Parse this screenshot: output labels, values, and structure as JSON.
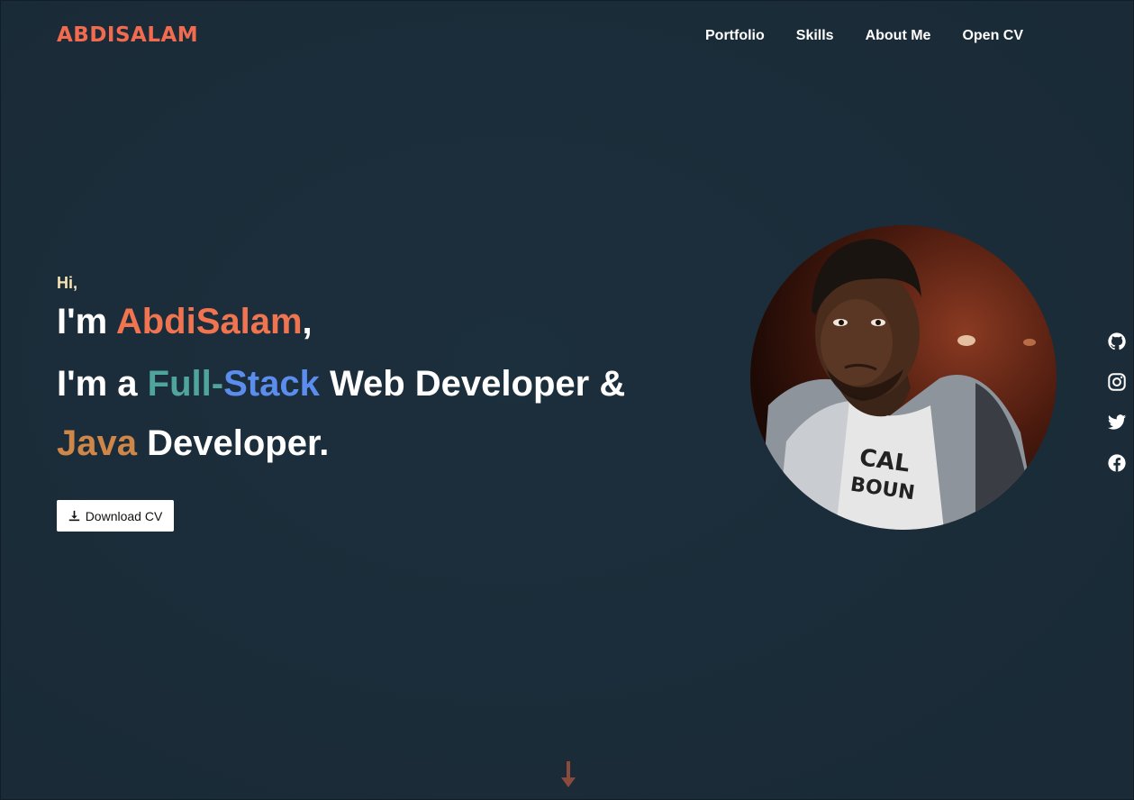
{
  "brand": {
    "logo_text": "ABDISALAM",
    "accent_color": "#f26b4f"
  },
  "nav": {
    "items": [
      {
        "label": "Portfolio"
      },
      {
        "label": "Skills"
      },
      {
        "label": "About Me"
      },
      {
        "label": "Open CV"
      }
    ]
  },
  "hero": {
    "greeting": "Hi,",
    "line1_prefix": "I'm ",
    "name": "AbdiSalam",
    "line1_suffix": ",",
    "line2_prefix": "I'm a ",
    "line2_full": "Full-",
    "line2_stack": "Stack",
    "line2_suffix": " Web Developer &",
    "line3_java": "Java",
    "line3_suffix": " Developer.",
    "download_label": "Download CV",
    "download_icon": "download-icon"
  },
  "profile_photo": {
    "icon": "profile-photo"
  },
  "social": {
    "icons": [
      "github-icon",
      "instagram-icon",
      "twitter-icon",
      "facebook-icon"
    ]
  },
  "scroll": {
    "icon": "arrow-down-icon",
    "color": "#8a4a3c"
  },
  "colors": {
    "background": "#1c2d3a",
    "name": "#f07450",
    "full": "#4fa59c",
    "stack": "#5a8ded",
    "java": "#cf8649",
    "greeting": "#f6e3b4"
  }
}
